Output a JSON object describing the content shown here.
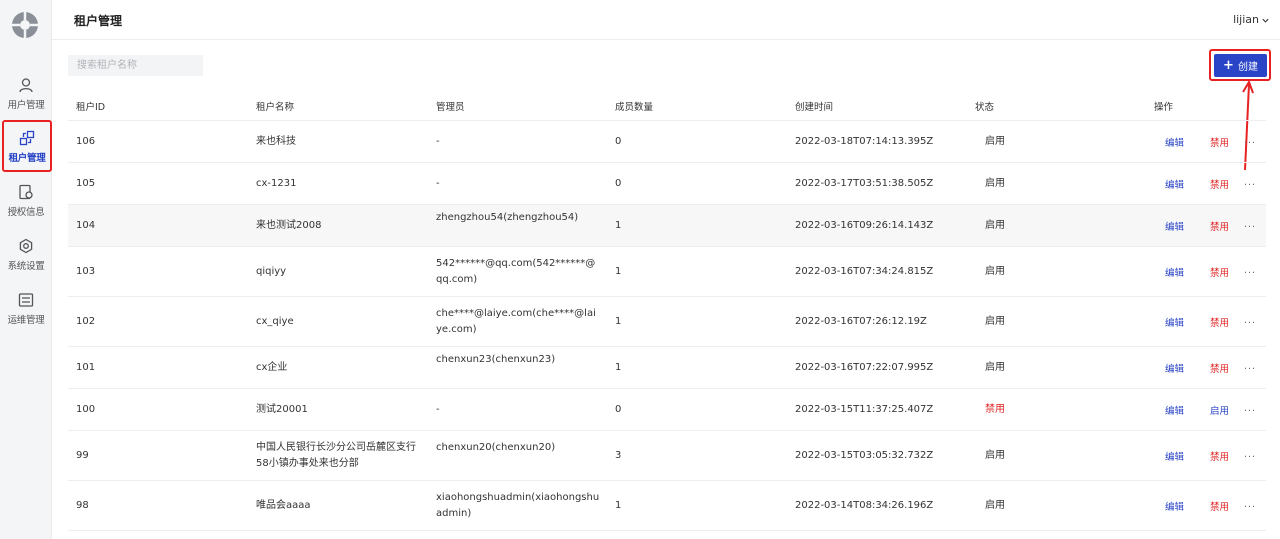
{
  "sidebar": {
    "items": [
      {
        "label": "用户管理",
        "icon": "user-icon",
        "active": false
      },
      {
        "label": "租户管理",
        "icon": "tenant-icon",
        "active": true
      },
      {
        "label": "授权信息",
        "icon": "license-icon",
        "active": false
      },
      {
        "label": "系统设置",
        "icon": "settings-icon",
        "active": false
      },
      {
        "label": "运维管理",
        "icon": "ops-icon",
        "active": false
      }
    ]
  },
  "header": {
    "title": "租户管理",
    "user": "lijian"
  },
  "search": {
    "placeholder": "搜索租户名称",
    "value": ""
  },
  "create_button": {
    "label": "创建"
  },
  "table": {
    "columns": [
      "租户ID",
      "租户名称",
      "管理员",
      "成员数量",
      "创建时间",
      "状态",
      "操作"
    ],
    "rows": [
      {
        "id": "106",
        "name": "来也科技",
        "admin": "-",
        "members": "0",
        "created": "2022-03-18T07:14:13.395Z",
        "status": "启用",
        "toggle": "禁用"
      },
      {
        "id": "105",
        "name": "cx-1231",
        "admin": "-",
        "members": "0",
        "created": "2022-03-17T03:51:38.505Z",
        "status": "启用",
        "toggle": "禁用"
      },
      {
        "id": "104",
        "name": "来也测试2008",
        "admin": "zhengzhou54(zhengzhou54)",
        "members": "1",
        "created": "2022-03-16T09:26:14.143Z",
        "status": "启用",
        "toggle": "禁用"
      },
      {
        "id": "103",
        "name": "qiqiyy",
        "admin": "542******@qq.com(542******@qq.com)",
        "members": "1",
        "created": "2022-03-16T07:34:24.815Z",
        "status": "启用",
        "toggle": "禁用"
      },
      {
        "id": "102",
        "name": "cx_qiye",
        "admin": "che****@laiye.com(che****@laiye.com)",
        "members": "1",
        "created": "2022-03-16T07:26:12.19Z",
        "status": "启用",
        "toggle": "禁用"
      },
      {
        "id": "101",
        "name": "cx企业",
        "admin": "chenxun23(chenxun23)",
        "members": "1",
        "created": "2022-03-16T07:22:07.995Z",
        "status": "启用",
        "toggle": "禁用"
      },
      {
        "id": "100",
        "name": "测试20001",
        "admin": "-",
        "members": "0",
        "created": "2022-03-15T11:37:25.407Z",
        "status": "禁用",
        "toggle": "启用"
      },
      {
        "id": "99",
        "name": "中国人民银行长沙分公司岳麓区支行58小镇办事处来也分部",
        "admin": "chenxun20(chenxun20)",
        "members": "3",
        "created": "2022-03-15T03:05:32.732Z",
        "status": "启用",
        "toggle": "禁用"
      },
      {
        "id": "98",
        "name": "唯品会aaaa",
        "admin": "xiaohongshuadmin(xiaohongshuadmin)",
        "members": "1",
        "created": "2022-03-14T08:34:26.196Z",
        "status": "启用",
        "toggle": "禁用"
      }
    ],
    "edit_label": "编辑",
    "more_label": "..."
  },
  "colors": {
    "primary": "#2944c7",
    "danger": "#e02424",
    "annotation": "#e62222"
  }
}
